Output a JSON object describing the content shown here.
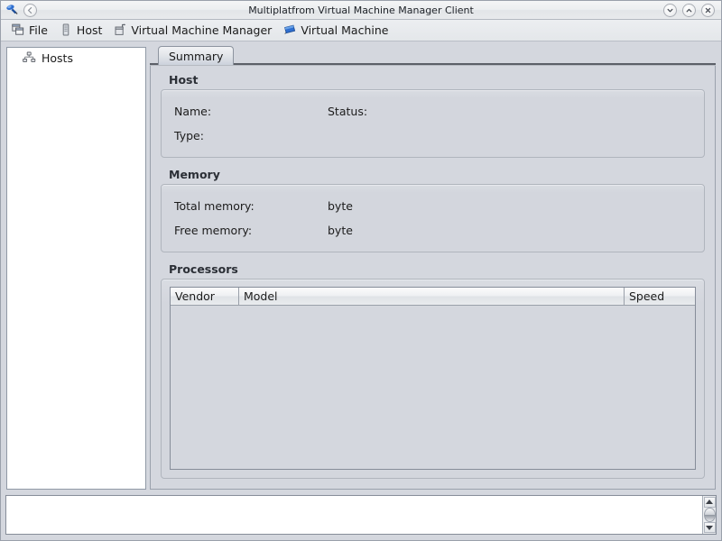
{
  "window": {
    "title": "Multiplatfrom Virtual Machine Manager Client",
    "app_icon": "plug-icon",
    "back_button_icon": "back-circle-icon",
    "controls": [
      {
        "name": "minimize",
        "icon": "chevron-down-icon"
      },
      {
        "name": "maximize",
        "icon": "chevron-up-icon"
      },
      {
        "name": "close",
        "icon": "close-x-icon"
      }
    ]
  },
  "menubar": {
    "items": [
      {
        "label": "File",
        "icon": "windows-stack-icon"
      },
      {
        "label": "Host",
        "icon": "server-icon"
      },
      {
        "label": "Virtual Machine Manager",
        "icon": "manager-box-icon"
      },
      {
        "label": "Virtual Machine",
        "icon": "blue-monitor-icon"
      }
    ]
  },
  "sidebar": {
    "tree": [
      {
        "label": "Hosts",
        "icon": "hosts-network-icon"
      }
    ]
  },
  "tabs": [
    {
      "label": "Summary",
      "selected": true
    }
  ],
  "summary": {
    "host": {
      "title": "Host",
      "fields": [
        {
          "label": "Name:",
          "value": ""
        },
        {
          "label": "Status:",
          "value": ""
        },
        {
          "label": "Type:",
          "value": ""
        }
      ]
    },
    "memory": {
      "title": "Memory",
      "fields": [
        {
          "label": "Total memory:",
          "value": "byte"
        },
        {
          "label": "Free memory:",
          "value": "byte"
        }
      ]
    },
    "processors": {
      "title": "Processors",
      "columns": [
        "Vendor",
        "Model",
        "Speed"
      ],
      "rows": []
    }
  },
  "logpanel": {
    "text": "",
    "scrollbar": {
      "up_icon": "triangle-up-icon",
      "down_icon": "triangle-down-icon",
      "thumb": "scroll-thumb"
    }
  },
  "colors": {
    "panel": "#d4d7de",
    "titlebar": "#eceef0",
    "accent_blue": "#2a5db0",
    "border": "#9aa1ac"
  }
}
